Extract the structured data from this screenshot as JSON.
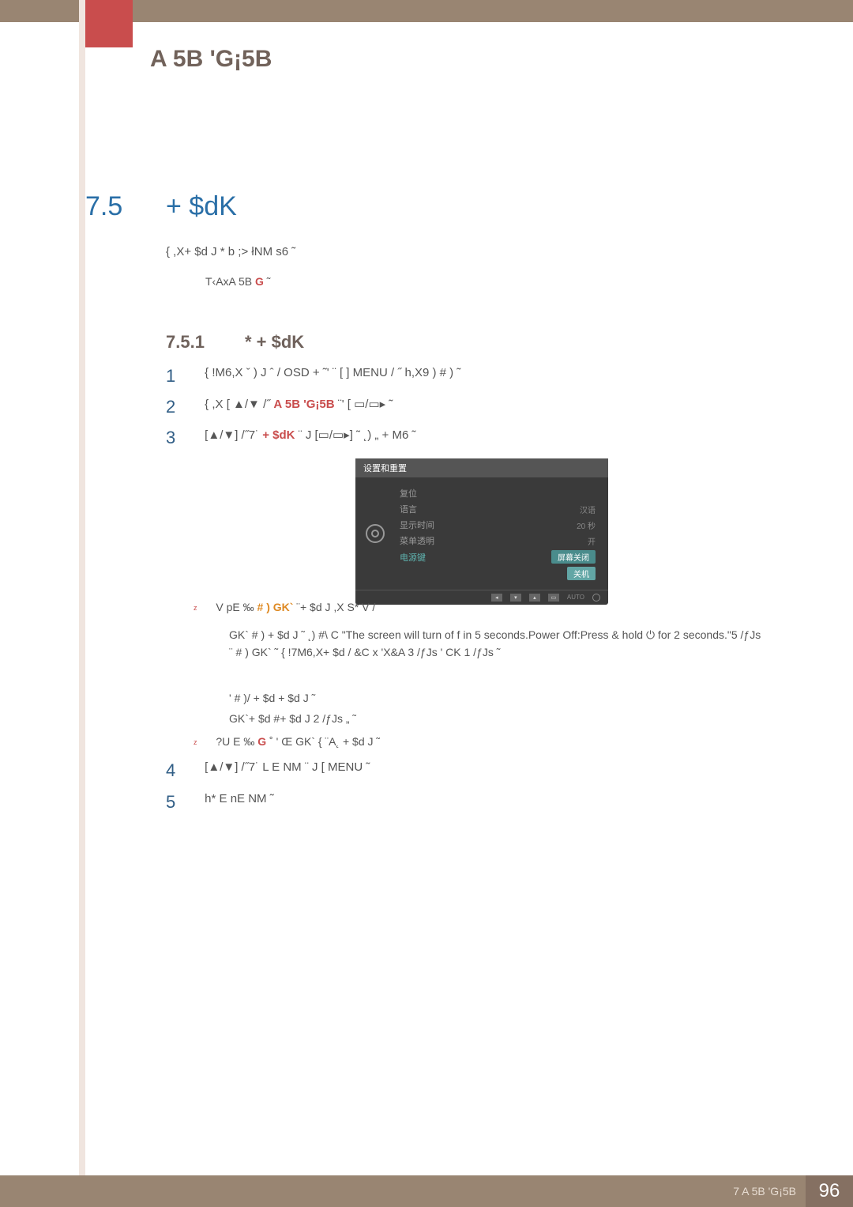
{
  "header": {
    "chapter_title": "A 5B 'G¡5B"
  },
  "section": {
    "num": "7.5",
    "title": "+ $dK"
  },
  "note": {
    "line": "{  ,X+ $d  J *  b ;>  łNM s6  ˜",
    "sub_pre": "T‹AxA 5B    ",
    "sub_g": "G",
    "sub_post": "    ˜"
  },
  "subsection": {
    "num": "7.5.1",
    "title": "*    + $dK"
  },
  "steps": {
    "s1": "{  !M6,X ˇ )  J  ˆ  /  OSD              + ˜'    ¨  [         ] MENU    / ˝ h,X9   ) # ) ˜",
    "s2_pre": "{   ,X  [      ",
    "s2_arrow": "▲/▼",
    "s2_mid": "  /˝  ",
    "s2_red": "A 5B 'G¡5B",
    "s2_post": " ¨'    [      ▭/▭▸ ˜",
    "s3_pre": "[",
    "s3_arrow": "▲/▼",
    "s3_mid": "] /˝7˙  ",
    "s3_red": "+ $dK",
    "s3_post": " ¨  J     [▭/▭▸] ˜  ˛)  „  + M6 ˜",
    "s4_pre": "[",
    "s4_arrow": "▲/▼",
    "s4_post": "] /˝7˙  L E NM ¨  J  [      MENU  ˜",
    "s5": "h* E  nE NM ˜"
  },
  "osd": {
    "title": "设置和重置",
    "rows": {
      "reset": "复位",
      "lang_l": "语言",
      "lang_v": "汉语",
      "disp_l": "显示时间",
      "disp_v": "20 秒",
      "trans_l": "菜单透明",
      "trans_v": "开",
      "pwr_l": "电源键",
      "pwr_v1": "屏幕关闭",
      "pwr_v2": "关机"
    },
    "auto": "AUTO"
  },
  "bullets": {
    "b1_pre": "V pE  ‰  ",
    "b1_hl": "# ) GK`",
    "b1_post": "  ¨+ $d  J ,X S*   V    /",
    "p1": "GK` # )    + $d  J  ˜  ˛)     #\\ C  \"The screen will turn of              f in 5 seconds.Power Off:Press & hold ⏻ for 2 seconds.\"5 /ƒJs   ¨ # )     GK` ˜ {  !7M6,X+ $d  / &C x  'X&A 3  /ƒJs '  CK 1   /ƒJs ˜",
    "p2": "'   # )/     + $d    + $d  J  ˜",
    "p3": "GK`+ $d    #+ $d  J  2      /ƒJs „   ˜",
    "b2_pre": "?U  E  ‰  ",
    "b2_g": "G",
    "b2_post": "    ˚ '  Œ GK` {  ¨A˛  + $d  J  ˜"
  },
  "footer": {
    "text": "7 A 5B 'G¡5B",
    "page": "96"
  }
}
